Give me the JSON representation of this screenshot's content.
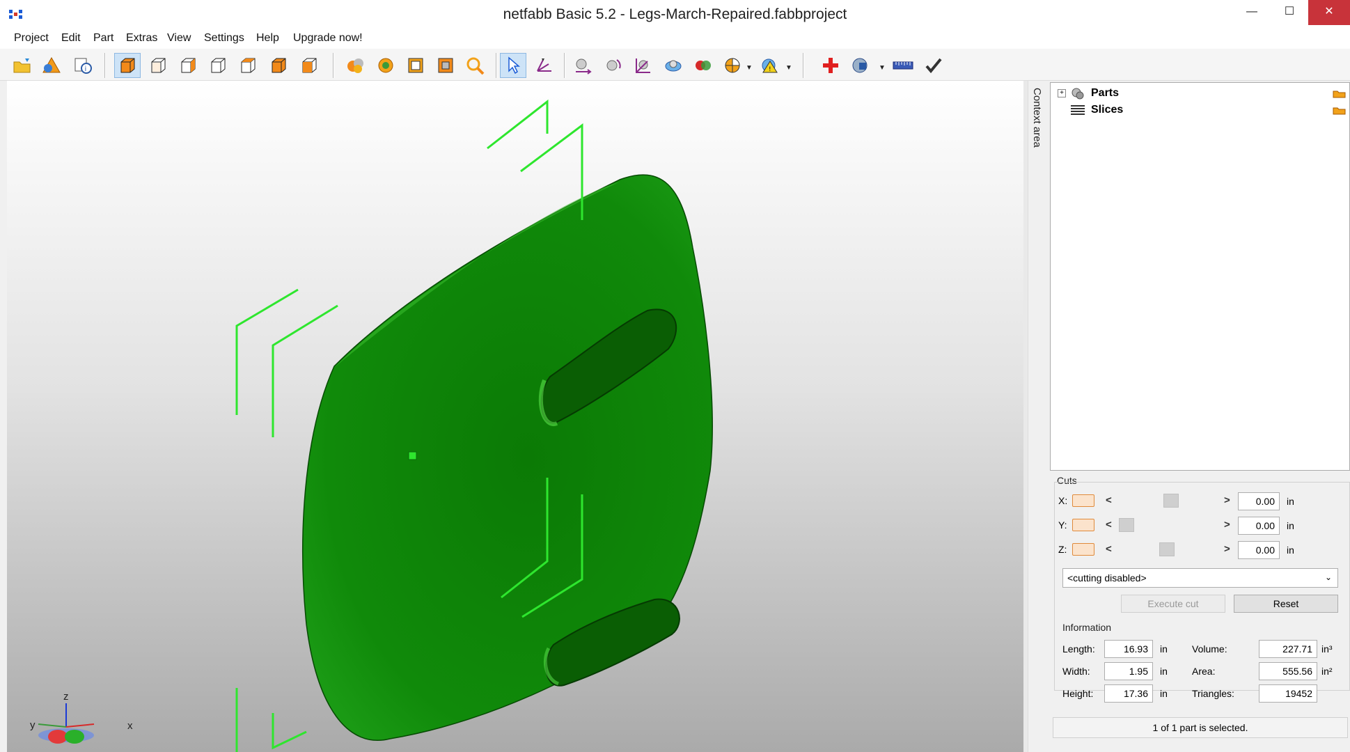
{
  "window": {
    "title": "netfabb Basic 5.2 - Legs-March-Repaired.fabbproject",
    "minimize_glyph": "—",
    "maximize_glyph": "☐",
    "close_glyph": "✕"
  },
  "menu": {
    "items": [
      "Project",
      "Edit",
      "Part",
      "Extras",
      "View",
      "Settings",
      "Help",
      "Upgrade now!"
    ]
  },
  "toolbar": {
    "icons": [
      "open-project-icon",
      "add-part-icon",
      "project-info-icon",
      "view-3d-icon",
      "view-front-icon",
      "view-back-icon",
      "view-left-icon",
      "view-right-icon",
      "view-top-icon",
      "view-bottom-icon",
      "parts-color-icon",
      "shaded-view-icon",
      "wireframe-icon",
      "transparent-icon",
      "zoom-icon",
      "select-tool-icon",
      "measure-tool-icon",
      "move-part-icon",
      "rotate-part-icon",
      "scale-part-icon",
      "align-icon",
      "merge-icon",
      "boolean-icon",
      "analysis-icon",
      "warning-icon",
      "repair-icon",
      "export-icon",
      "ruler-icon",
      "apply-icon"
    ]
  },
  "viewport": {
    "axis_labels": {
      "z": "z",
      "y": "y",
      "x": "x"
    },
    "model_color": "#118a0a",
    "bbox_color": "#2ee62e"
  },
  "context_tab": {
    "label": "Context area"
  },
  "tree": {
    "items": [
      {
        "label": "Parts",
        "expander": "+"
      },
      {
        "label": "Slices",
        "expander": ""
      }
    ]
  },
  "cuts": {
    "title": "Cuts",
    "axes": [
      {
        "label": "X:",
        "value": "0.00",
        "unit": "in",
        "position": 0.55
      },
      {
        "label": "Y:",
        "value": "0.00",
        "unit": "in",
        "position": 0.05
      },
      {
        "label": "Z:",
        "value": "0.00",
        "unit": "in",
        "position": 0.5
      }
    ],
    "arrow_left": "<",
    "arrow_right": ">",
    "mode": "<cutting disabled>",
    "execute_label": "Execute cut",
    "reset_label": "Reset"
  },
  "information": {
    "title": "Information",
    "length_label": "Length:",
    "length_value": "16.93",
    "length_unit": "in",
    "width_label": "Width:",
    "width_value": "1.95",
    "width_unit": "in",
    "height_label": "Height:",
    "height_value": "17.36",
    "height_unit": "in",
    "volume_label": "Volume:",
    "volume_value": "227.71",
    "volume_unit": "in³",
    "area_label": "Area:",
    "area_value": "555.56",
    "area_unit": "in²",
    "triangles_label": "Triangles:",
    "triangles_value": "19452"
  },
  "status": {
    "text": "1 of 1 part is selected."
  }
}
